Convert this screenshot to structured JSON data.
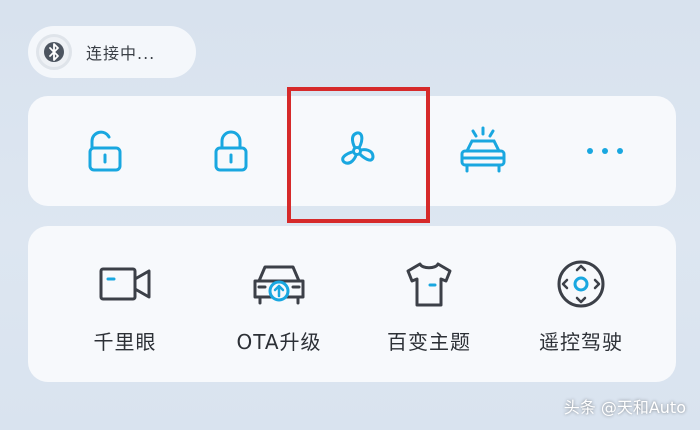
{
  "status": {
    "connection_text": "连接中...",
    "icon": "bluetooth-icon"
  },
  "quick_controls": [
    {
      "name": "unlock-icon"
    },
    {
      "name": "lock-icon"
    },
    {
      "name": "fan-icon"
    },
    {
      "name": "car-lights-icon"
    },
    {
      "name": "more-icon"
    }
  ],
  "features": [
    {
      "label": "千里眼",
      "icon": "camera-icon"
    },
    {
      "label": "OTA升级",
      "icon": "car-update-icon"
    },
    {
      "label": "百变主题",
      "icon": "tshirt-icon"
    },
    {
      "label": "遥控驾驶",
      "icon": "remote-dpad-icon"
    }
  ],
  "watermark": "头条 @天和Auto",
  "colors": {
    "accent": "#19a7e0",
    "icon_gray": "#3c4048",
    "highlight": "#d62a2a"
  }
}
